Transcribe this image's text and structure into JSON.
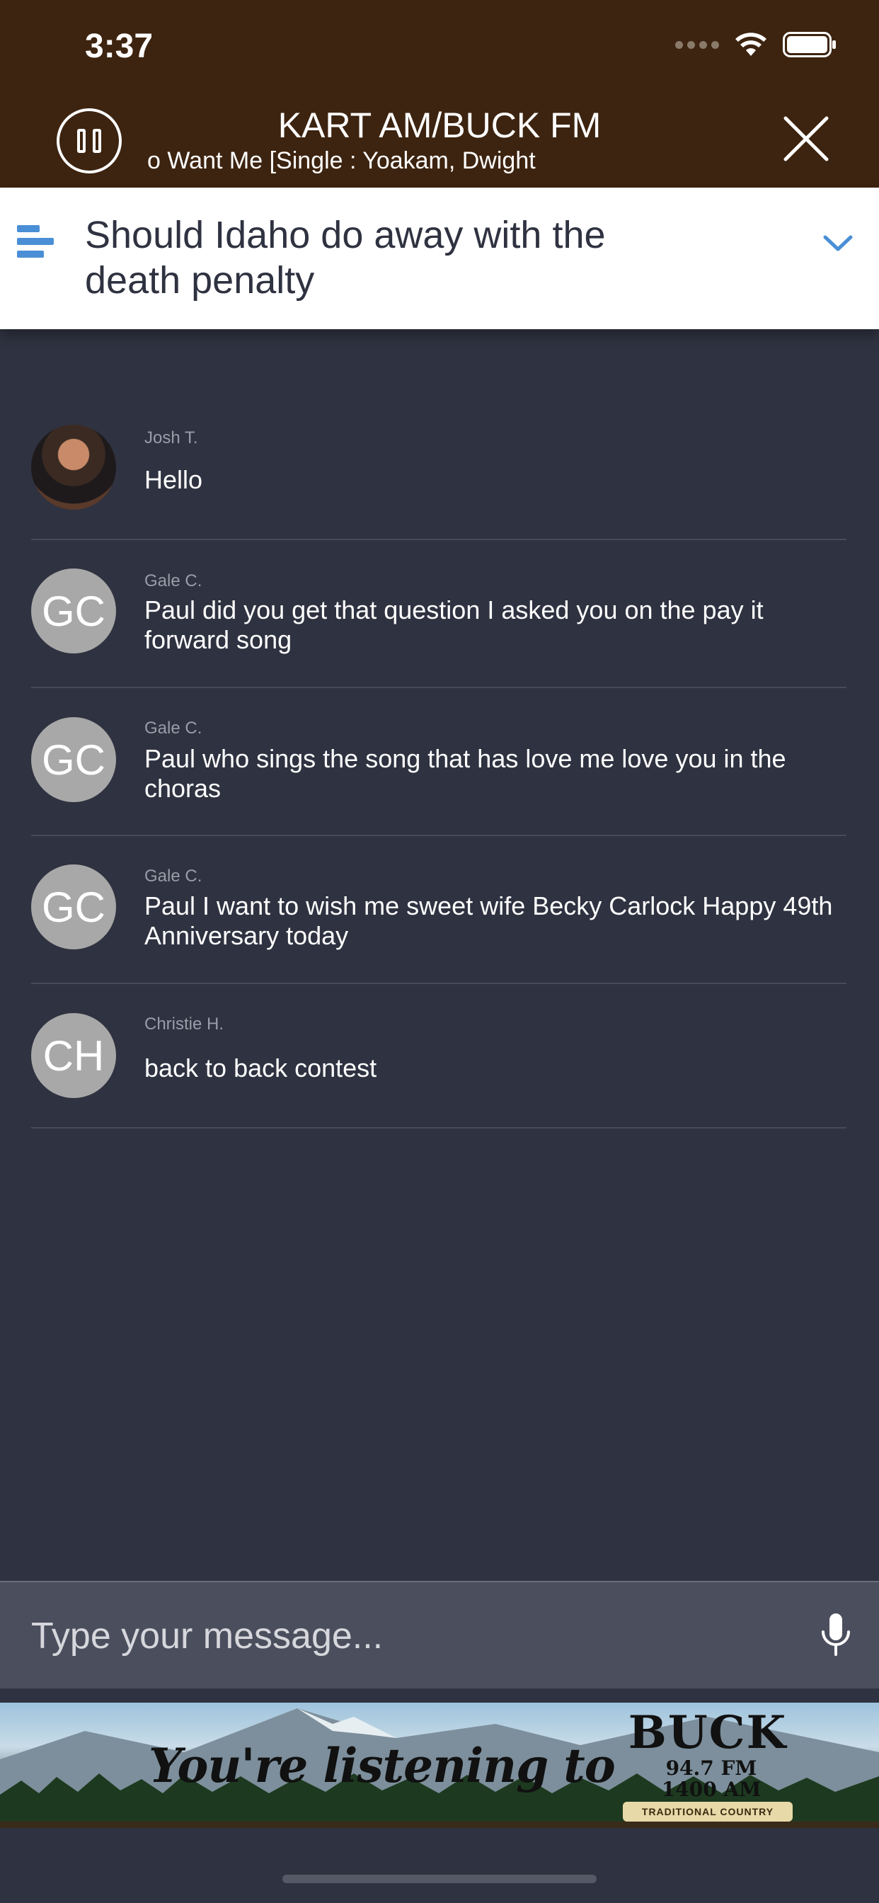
{
  "status": {
    "time": "3:37"
  },
  "player": {
    "station": "KART AM/BUCK FM",
    "track": "o Want Me [Single : Yoakam, Dwight"
  },
  "topic": {
    "title": "Should Idaho do away with the death penalty"
  },
  "messages": [
    {
      "author": "Josh T.",
      "initials": "",
      "text": "Hello"
    },
    {
      "author": "Gale C.",
      "initials": "GC",
      "text": "Paul did you get that question I asked you on the pay it forward song"
    },
    {
      "author": "Gale C.",
      "initials": "GC",
      "text": "Paul who sings the song that has love me love  you in the choras"
    },
    {
      "author": "Gale C.",
      "initials": "GC",
      "text": "Paul I want to wish me sweet wife Becky Carlock Happy 49th Anniversary  today"
    },
    {
      "author": "Christie H.",
      "initials": "CH",
      "text": "back to back contest"
    }
  ],
  "composer": {
    "placeholder": "Type your message..."
  },
  "banner": {
    "text": "You're listening to",
    "brand": "BUCK",
    "freq_fm": "94.7 FM",
    "freq_am": "1400 AM",
    "tagline": "TRADITIONAL COUNTRY"
  },
  "colors": {
    "header": "#3d2410",
    "background": "#2f3240",
    "accent": "#4a8fd6",
    "input": "#4b4e5d"
  }
}
